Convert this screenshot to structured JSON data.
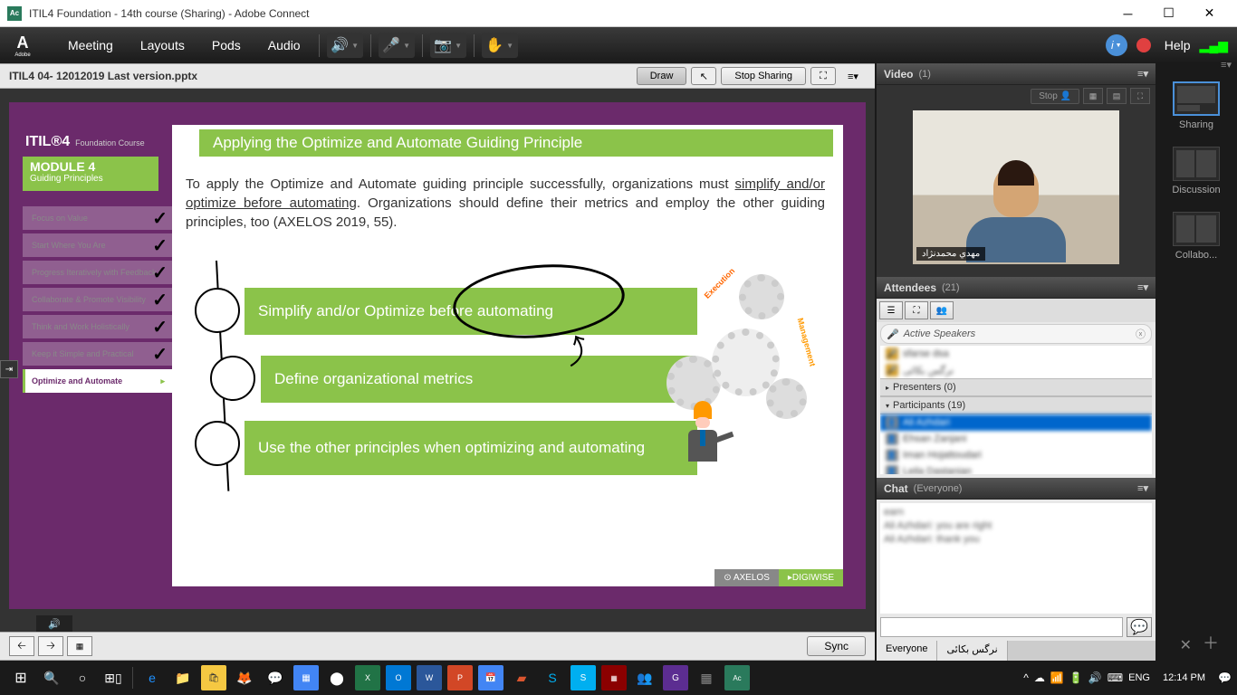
{
  "window": {
    "title": "ITIL4 Foundation - 14th course (Sharing) - Adobe Connect"
  },
  "menubar": {
    "adobe": "Adobe",
    "meeting": "Meeting",
    "layouts": "Layouts",
    "pods": "Pods",
    "audio": "Audio",
    "help": "Help"
  },
  "share": {
    "filename": "ITIL4 04- 12012019 Last version.pptx",
    "draw": "Draw",
    "stop": "Stop Sharing",
    "sync": "Sync"
  },
  "slide": {
    "course_brand": "ITIL®4",
    "course_sub": "Foundation Course",
    "module_num": "MODULE 4",
    "module_sub": "Guiding Principles",
    "title": "Applying the Optimize and Automate Guiding Principle",
    "body_pre": "To apply the Optimize and Automate guiding principle successfully, organizations must ",
    "body_u": "simplify and/or optimize before automating",
    "body_post": ". Organizations should define their metrics and employ the other guiding principles, too (AXELOS 2019, 55).",
    "nav": [
      "Focus on Value",
      "Start Where You Are",
      "Progress Iteratively with Feedback",
      "Collaborate & Promote Visibility",
      "Think and Work Holistically",
      "Keep it Simple and Practical",
      "Optimize and Automate"
    ],
    "step1": "Simplify and/or Optimize before automating",
    "step2": "Define organizational metrics",
    "step3": "Use the other principles when optimizing and automating",
    "exec": "Execution",
    "mgmt": "Management",
    "axelos": "⊙ AXELOS",
    "digiwise": "▸DIGIWISE"
  },
  "video": {
    "title": "Video",
    "count": "(1)",
    "stop": "Stop",
    "presenter_name": "مهدي محمدنژاد"
  },
  "attendees": {
    "title": "Attendees",
    "count": "(21)",
    "active_speakers": "Active Speakers",
    "presenters": "Presenters (0)",
    "participants": "Participants (19)",
    "speaker1": "sfarse dsa",
    "speaker2": "نرگس بكائى",
    "p1": "Ali Azhdari",
    "p2": "Ehsan Zanjani",
    "p3": "Iman Hojattoudari",
    "p4": "Leila Dastanian"
  },
  "chat": {
    "title": "Chat",
    "scope": "(Everyone)",
    "line1": "earn",
    "line2": "Ali Azhdari: you are right",
    "line3": "Ali Azhdari: thank you",
    "tab1": "Everyone",
    "tab2": "نرگس بكائى"
  },
  "layouts": {
    "sharing": "Sharing",
    "discussion": "Discussion",
    "collabo": "Collabo..."
  },
  "taskbar": {
    "lang": "ENG",
    "time": "12:14 PM"
  }
}
